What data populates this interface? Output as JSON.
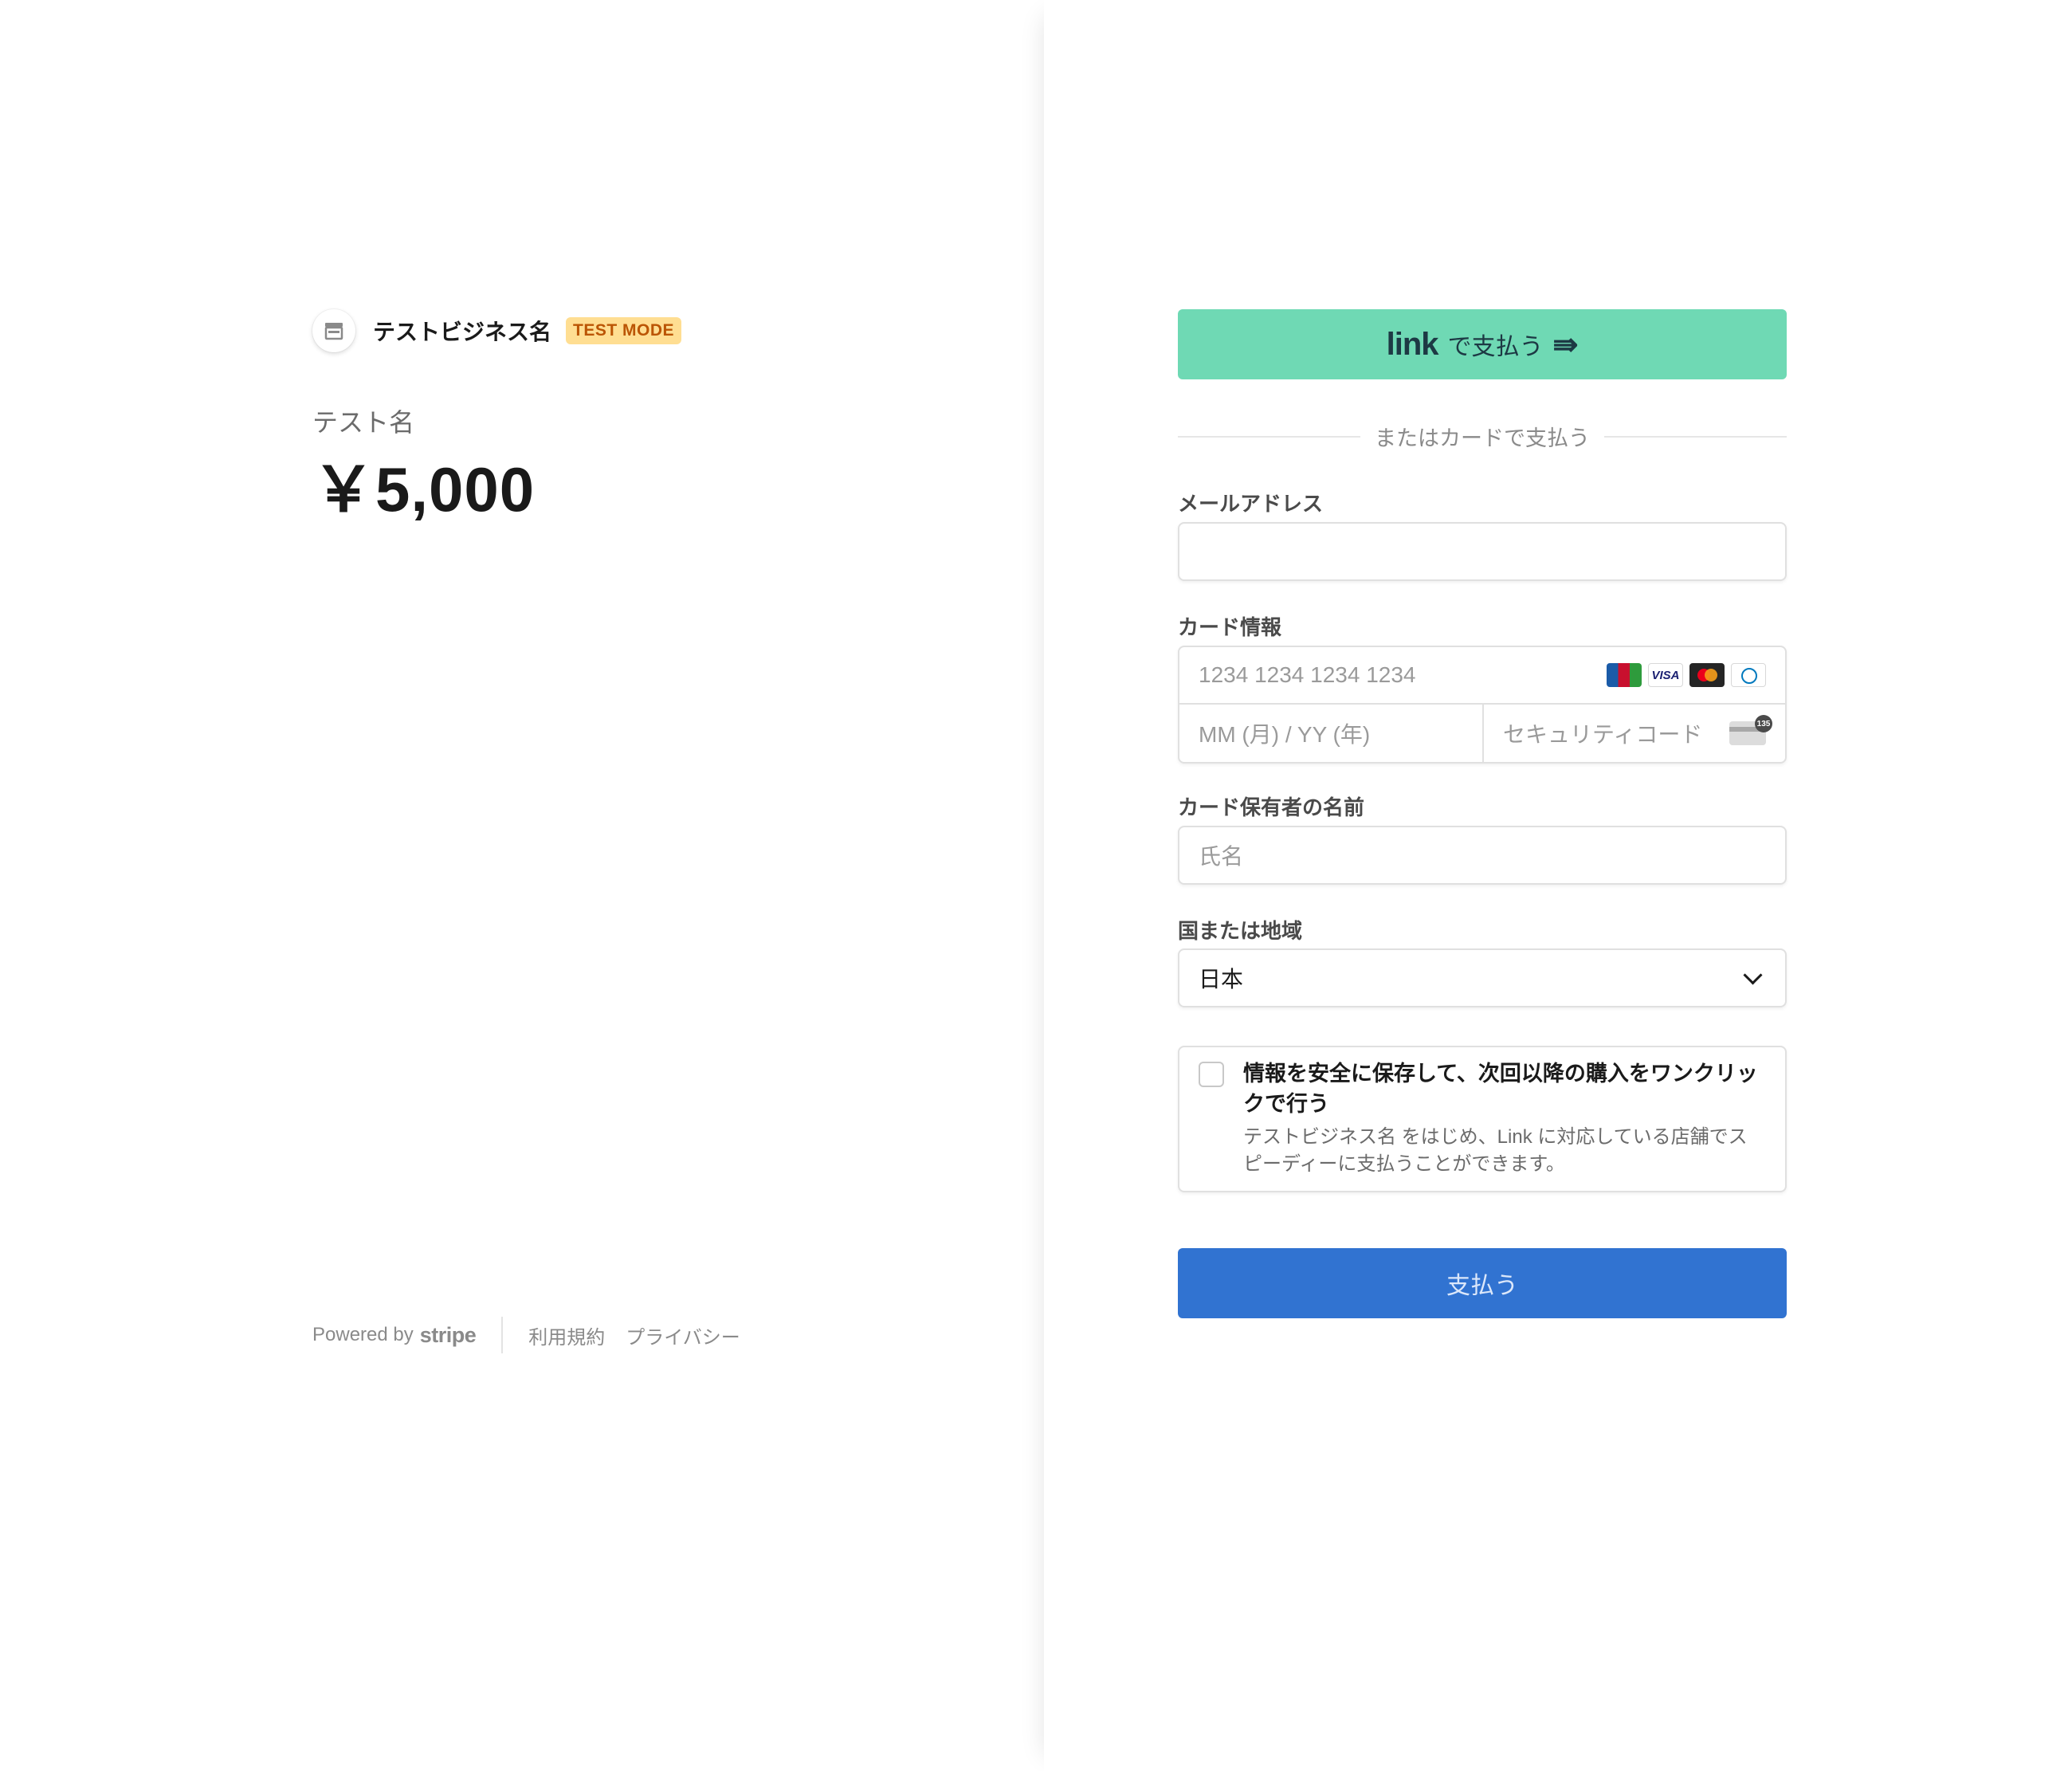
{
  "merchant": {
    "name": "テストビジネス名",
    "badge": "TEST MODE",
    "logo_icon": "store-icon"
  },
  "product": {
    "name": "テスト名",
    "price": "￥5,000"
  },
  "footer": {
    "powered_by": "Powered by",
    "brand": "stripe",
    "terms": "利用規約",
    "privacy": "プライバシー"
  },
  "link_button": {
    "logo": "link",
    "label": "で支払う",
    "arrow": "⇛",
    "color": "#6fd9b4"
  },
  "divider_text": "またはカードで支払う",
  "email": {
    "label": "メールアドレス",
    "value": "",
    "placeholder": ""
  },
  "card": {
    "label": "カード情報",
    "number_placeholder": "1234 1234 1234 1234",
    "expiry_placeholder": "MM (月) / YY (年)",
    "cvc_placeholder": "セキュリティコード",
    "brands": [
      "JCB",
      "VISA",
      "Mastercard",
      "Diners Club"
    ],
    "visa_text": "VISA",
    "cvc_badge": "135"
  },
  "cardholder": {
    "label": "カード保有者の名前",
    "placeholder": "氏名"
  },
  "country": {
    "label": "国または地域",
    "selected": "日本"
  },
  "save_info": {
    "checked": false,
    "title": "情報を安全に保存して、次回以降の購入をワンクリックで行う",
    "description": "テストビジネス名 をはじめ、Link に対応している店舗でスピーディーに支払うことができます。"
  },
  "pay_button": {
    "label": "支払う",
    "color": "#3173d1"
  }
}
